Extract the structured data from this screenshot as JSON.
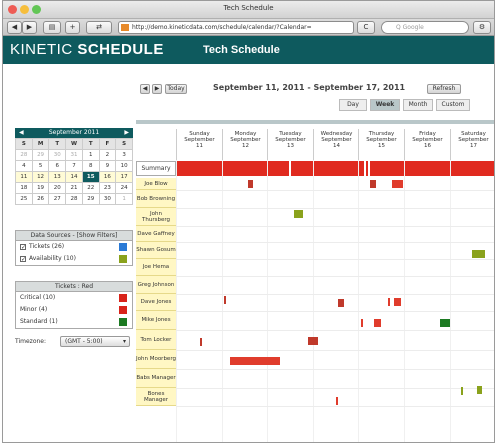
{
  "window": {
    "title": "Tech Schedule"
  },
  "browser": {
    "back": "◀",
    "forward": "▶",
    "plus": "+",
    "url": "http://demo.kineticdata.com/schedule/calendar/?Calendar=",
    "reload": "C",
    "search_placeholder": "Q Google"
  },
  "app": {
    "logo_light": "KINETIC ",
    "logo_bold": "SCHEDULE",
    "title": "Tech Schedule"
  },
  "nav": {
    "prev": "◀",
    "next": "▶",
    "today": "Today",
    "range": "September 11, 2011 - September 17, 2011",
    "refresh": "Refresh",
    "views": [
      "Day",
      "Week",
      "Month",
      "Custom"
    ]
  },
  "mini_calendar": {
    "month": "September 2011",
    "prev": "◀",
    "next": "▶",
    "days": [
      "S",
      "M",
      "T",
      "W",
      "T",
      "F",
      "S"
    ],
    "weeks": [
      [
        "28",
        "29",
        "30",
        "31",
        "1",
        "2",
        "3"
      ],
      [
        "4",
        "5",
        "6",
        "7",
        "8",
        "9",
        "10"
      ],
      [
        "11",
        "12",
        "13",
        "14",
        "15",
        "16",
        "17"
      ],
      [
        "18",
        "19",
        "20",
        "21",
        "22",
        "23",
        "24"
      ],
      [
        "25",
        "26",
        "27",
        "28",
        "29",
        "30",
        "1"
      ]
    ],
    "selected": "15"
  },
  "data_sources": {
    "title": "Data Sources - [Show Filters]",
    "items": [
      {
        "label": "Tickets (26)",
        "color": "#2a7ad6"
      },
      {
        "label": "Availability (10)",
        "color": "#8aa21c"
      }
    ]
  },
  "tickets_legend": {
    "title": "Tickets : Red",
    "items": [
      {
        "label": "Critical (10)",
        "color": "#d8231a"
      },
      {
        "label": "Minor (4)",
        "color": "#d8231a"
      },
      {
        "label": "Standard (1)",
        "color": "#1c7a22"
      }
    ]
  },
  "timezone": {
    "label": "Timezone:",
    "value": "(GMT - 5:00)"
  },
  "calendar": {
    "days": [
      {
        "name": "Sunday",
        "month": "September",
        "num": "11"
      },
      {
        "name": "Monday",
        "month": "September",
        "num": "12"
      },
      {
        "name": "Tuesday",
        "month": "September",
        "num": "13"
      },
      {
        "name": "Wednesday",
        "month": "September",
        "num": "14"
      },
      {
        "name": "Thursday",
        "month": "September",
        "num": "15"
      },
      {
        "name": "Friday",
        "month": "September",
        "num": "16"
      },
      {
        "name": "Saturday",
        "month": "September",
        "num": "17"
      }
    ],
    "summary_label": "Summary",
    "resources": [
      "Joe Blow",
      "Bob Browning",
      "John Thursberg",
      "Dave Gaffney",
      "Shawn Gosum",
      "Joe Hema",
      "Greg Johnson",
      "Dave Jones",
      "Mike Jones",
      "Tom Locker",
      "John Moorberg",
      "Babs Manager",
      "Bones Manager"
    ],
    "colors": {
      "critical": "#c0392b",
      "minor": "#e03c2c",
      "availability": "#8aa21c",
      "standard": "#1c7a22"
    }
  }
}
